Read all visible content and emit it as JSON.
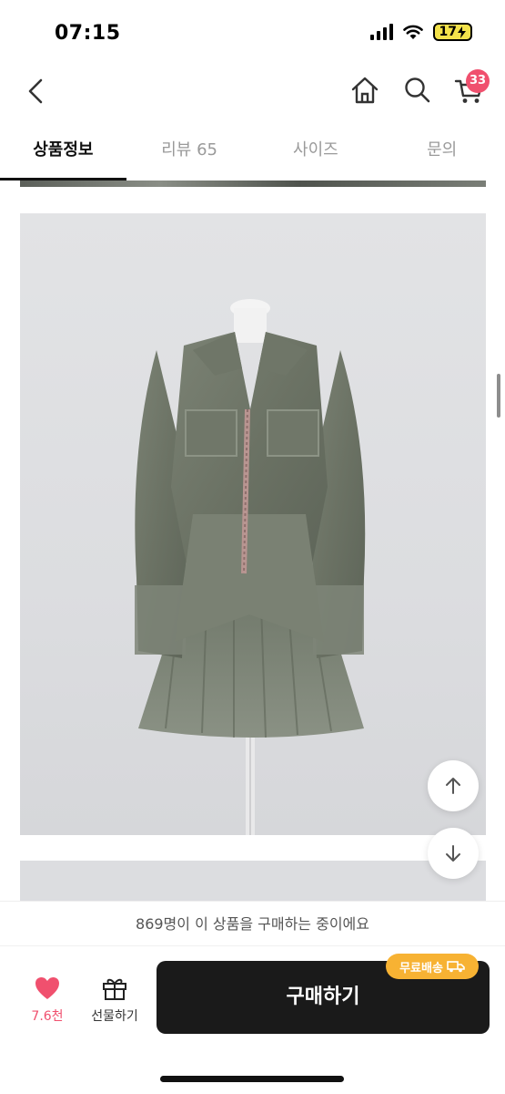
{
  "status_bar": {
    "time": "07:15",
    "battery": "17"
  },
  "header": {
    "back_icon": "chevron-left-icon",
    "home_icon": "home-icon",
    "search_icon": "search-icon",
    "cart_icon": "cart-icon",
    "cart_badge": "33"
  },
  "tabs": [
    {
      "label": "상품정보",
      "active": true
    },
    {
      "label": "리뷰 65",
      "active": false
    },
    {
      "label": "사이즈",
      "active": false
    },
    {
      "label": "문의",
      "active": false
    }
  ],
  "floating_buttons": {
    "up_icon": "arrow-up-icon",
    "down_icon": "arrow-down-icon"
  },
  "buyer_banner": "869명이 이 상품을 구매하는 중이에요",
  "bottom_bar": {
    "like_count": "7.6천",
    "gift_label": "선물하기",
    "buy_label": "구매하기",
    "shipping_badge": "무료배송"
  },
  "colors": {
    "accent_pink": "#f0506e",
    "buy_button": "#1a1a1a",
    "shipping_badge": "#f7b233"
  }
}
